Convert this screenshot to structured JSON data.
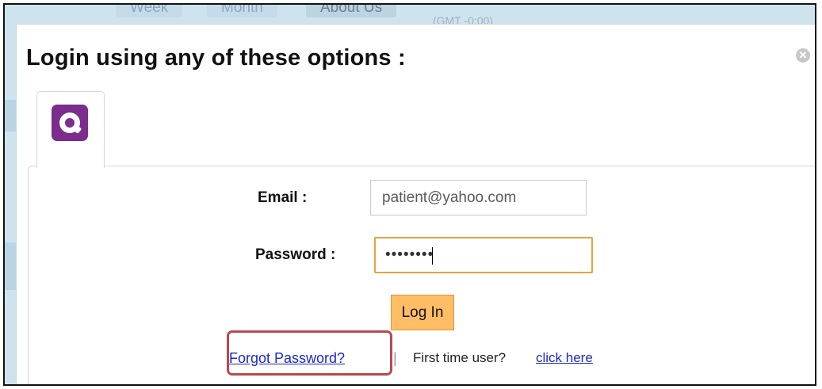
{
  "background": {
    "tabs": [
      {
        "label": "Week"
      },
      {
        "label": "Month"
      },
      {
        "label": "About Us"
      }
    ],
    "timezone": "(GMT -0:00)"
  },
  "modal": {
    "title": "Login using any of these options :",
    "close_icon": "close-circle-icon",
    "provider_tab": {
      "icon": "aol-logo-icon",
      "color": "#7b2c8c"
    }
  },
  "form": {
    "email_label": "Email :",
    "email_value": "patient@yahoo.com",
    "password_label": "Password :",
    "password_value": "••••••••",
    "login_label": "Log In",
    "forgot_label": "Forgot Password?",
    "separator": "|",
    "first_time_label": "First time user?",
    "click_here_label": "click here"
  },
  "colors": {
    "link": "#1a29c9",
    "button": "#ffbd66",
    "focus_border": "#e3a33f",
    "annotation": "#b74a4e"
  }
}
